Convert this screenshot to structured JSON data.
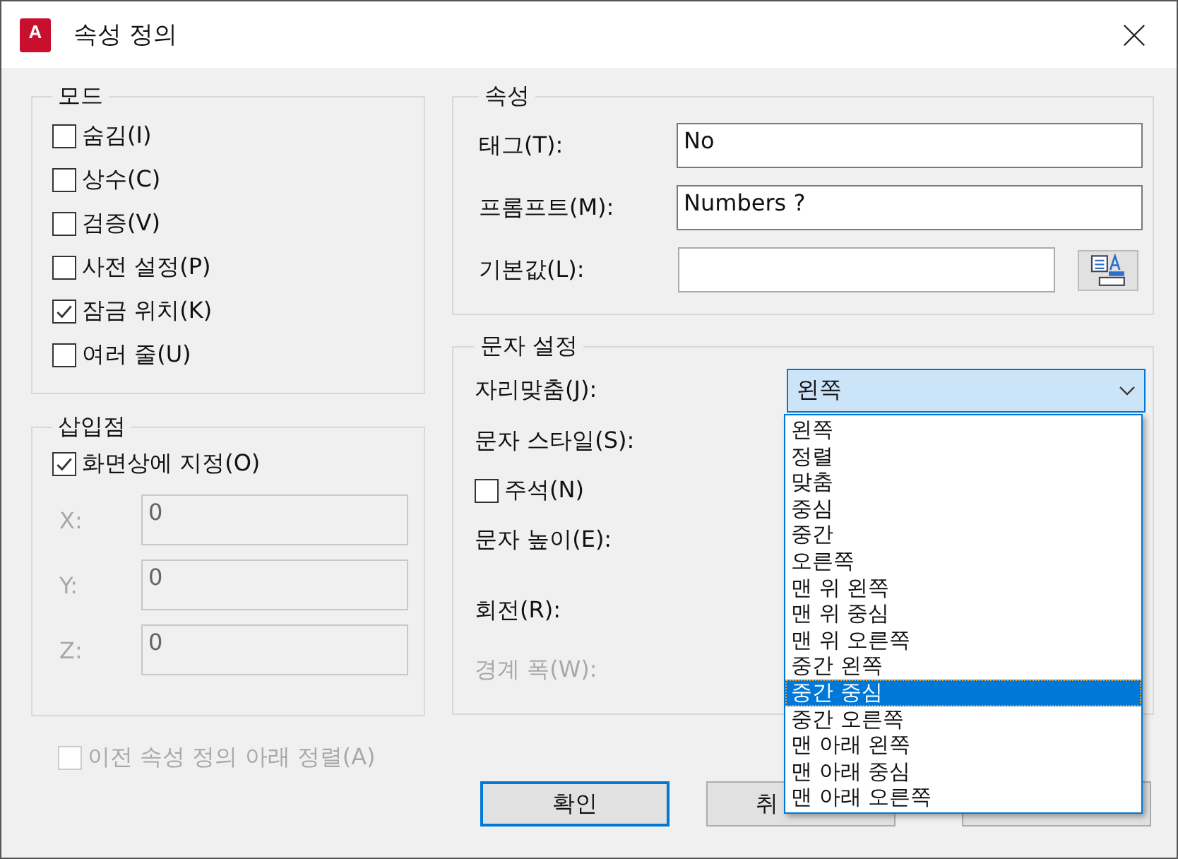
{
  "window": {
    "title": "속성 정의",
    "icon_label": "A"
  },
  "mode": {
    "title": "모드",
    "options": [
      {
        "label": "숨김(I)",
        "checked": false
      },
      {
        "label": "상수(C)",
        "checked": false
      },
      {
        "label": "검증(V)",
        "checked": false
      },
      {
        "label": "사전 설정(P)",
        "checked": false
      },
      {
        "label": "잠금 위치(K)",
        "checked": true
      },
      {
        "label": "여러 줄(U)",
        "checked": false
      }
    ]
  },
  "insertion_point": {
    "title": "삽입점",
    "specify_on_screen": {
      "label": "화면상에 지정(O)",
      "checked": true
    },
    "coordinates": [
      {
        "label": "X:",
        "value": "0",
        "disabled": true
      },
      {
        "label": "Y:",
        "value": "0",
        "disabled": true
      },
      {
        "label": "Z:",
        "value": "0",
        "disabled": true
      }
    ]
  },
  "align_below": {
    "label": "이전 속성 정의 아래 정렬(A)",
    "checked": false,
    "disabled": true
  },
  "attribute": {
    "title": "속성",
    "fields": [
      {
        "label": "태그(T):",
        "value": "No",
        "has_button": false
      },
      {
        "label": "프롬프트(M):",
        "value": "Numbers ?",
        "has_button": false
      },
      {
        "label": "기본값(L):",
        "has_button": true
      }
    ]
  },
  "text_settings": {
    "title": "문자 설정",
    "rows": [
      {
        "kind": "combo",
        "label": "자리맞춤(J):",
        "value": "왼쪽",
        "expanded": true,
        "disabled": false
      },
      {
        "kind": "label",
        "label": "문자 스타일(S):",
        "disabled": false
      },
      {
        "kind": "checkbox",
        "label": "주석(N)",
        "checked": false,
        "disabled": false
      },
      {
        "kind": "label",
        "label": "문자 높이(E):",
        "disabled": false
      },
      {
        "kind": "label",
        "label": "회전(R):",
        "disabled": false
      },
      {
        "kind": "label",
        "label": "경계 폭(W):",
        "disabled": true
      }
    ]
  },
  "dropdown": {
    "items": [
      {
        "label": "왼쪽",
        "selected": false
      },
      {
        "label": "정렬",
        "selected": false
      },
      {
        "label": "맞춤",
        "selected": false
      },
      {
        "label": "중심",
        "selected": false
      },
      {
        "label": "중간",
        "selected": false
      },
      {
        "label": "오른쪽",
        "selected": false
      },
      {
        "label": "맨 위 왼쪽",
        "selected": false
      },
      {
        "label": "맨 위 중심",
        "selected": false
      },
      {
        "label": "맨 위 오른쪽",
        "selected": false
      },
      {
        "label": "중간 왼쪽",
        "selected": false
      },
      {
        "label": "중간 중심",
        "selected": true
      },
      {
        "label": "중간 오른쪽",
        "selected": false
      },
      {
        "label": "맨 아래 왼쪽",
        "selected": false
      },
      {
        "label": "맨 아래 중심",
        "selected": false
      },
      {
        "label": "맨 아래 오른쪽",
        "selected": false
      }
    ]
  },
  "buttons": [
    {
      "label": "확인",
      "default": true,
      "label_clipped": false
    },
    {
      "label": "취",
      "default": false,
      "label_clipped": true
    },
    {
      "default": false
    }
  ]
}
